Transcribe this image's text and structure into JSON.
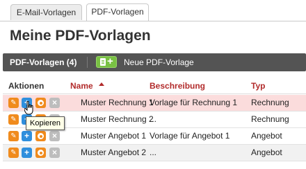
{
  "tabs": [
    {
      "label": "E-Mail-Vorlagen",
      "active": false
    },
    {
      "label": "PDF-Vorlagen",
      "active": true
    }
  ],
  "page_title": "Meine PDF-Vorlagen",
  "toolbar": {
    "section_label": "PDF-Vorlagen (4)",
    "new_button_icon": "add-document-icon",
    "new_label": "Neue PDF-Vorlage"
  },
  "table": {
    "headers": {
      "actions": "Aktionen",
      "name": "Name",
      "description": "Beschreibung",
      "type": "Typ"
    },
    "sort": {
      "column": "name",
      "direction": "ascending"
    },
    "rows": [
      {
        "name": "Muster Rechnung 1",
        "description": "Vorlage für Rechnung 1",
        "type": "Rechnung"
      },
      {
        "name": "Muster Rechnung 2",
        "description": "...",
        "type": "Rechnung"
      },
      {
        "name": "Muster Angebot 1",
        "description": "Vorlage für Angebot 1",
        "type": "Angebot"
      },
      {
        "name": "Muster Angebot 2",
        "description": "...",
        "type": "Angebot"
      }
    ],
    "row_actions": [
      "wrench-icon",
      "plus-icon",
      "gear-icon",
      "x-icon"
    ]
  },
  "tooltip": "Kopieren",
  "colors": {
    "accent": "#b22b2b",
    "toolbar": "#545454",
    "add_button": "#79c143",
    "highlight_row": "#fbdcdc"
  }
}
